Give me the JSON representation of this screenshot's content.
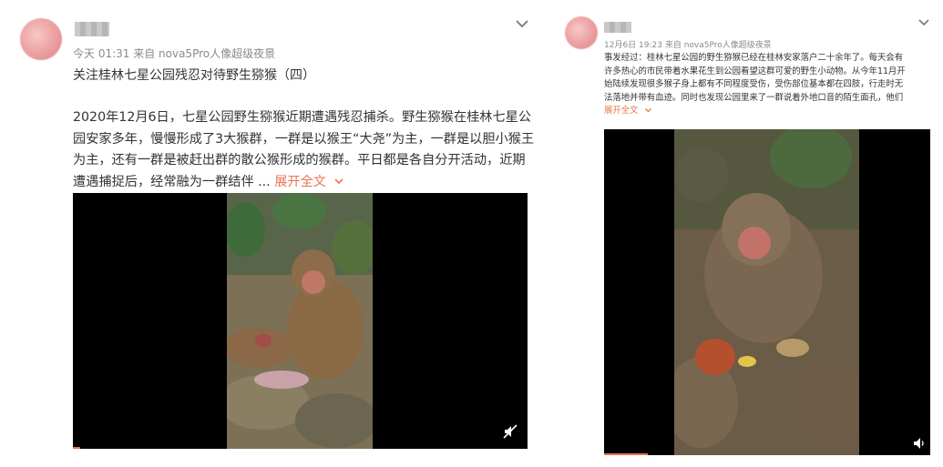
{
  "left_post": {
    "meta": "今天 01:31 来自 nova5Pro人像超级夜景",
    "title": "关注桂林七星公园残忍对待野生猕猴（四）",
    "body_lines": [
      "2020年12月6日，七星公园野生猕猴近期遭遇残忍捕杀。野生猕猴在桂林七星公",
      "园安家多年，慢慢形成了3大猴群，一群是以猴王“大尧”为主，一群是以胆小猴王",
      "为主，还有一群是被赶出群的散公猴形成的猴群。平日都是各自分开活动，近期",
      "遭遇捕捉后，经常融为一群结伴 ..."
    ],
    "expand_label": "展开全文",
    "video_muted_icon": "speaker-muted-icon"
  },
  "right_post": {
    "meta": "12月6日 19:23 来自 nova5Pro人像超级夜景",
    "body_lines": [
      "事发经过：桂林七星公园的野生猕猴已经在桂林安家落户二十余年了。每天会有",
      "许多热心的市民带着水果花生到公园看望这群可爱的野生小动物。从今年11月开",
      "始陆续发现很多猴子身上都有不同程度受伤，受伤部位基本都在四肢，行走时无",
      "法落地并带有血迹。同时也发现公园里来了一群说着外地口音的陌生面孔，他们"
    ],
    "expand_label": "展开全文",
    "video_sound_icon": "speaker-icon"
  },
  "colors": {
    "expand_link": "#eb7350",
    "meta_text": "#8a8a8a",
    "video_bg": "#000000"
  }
}
